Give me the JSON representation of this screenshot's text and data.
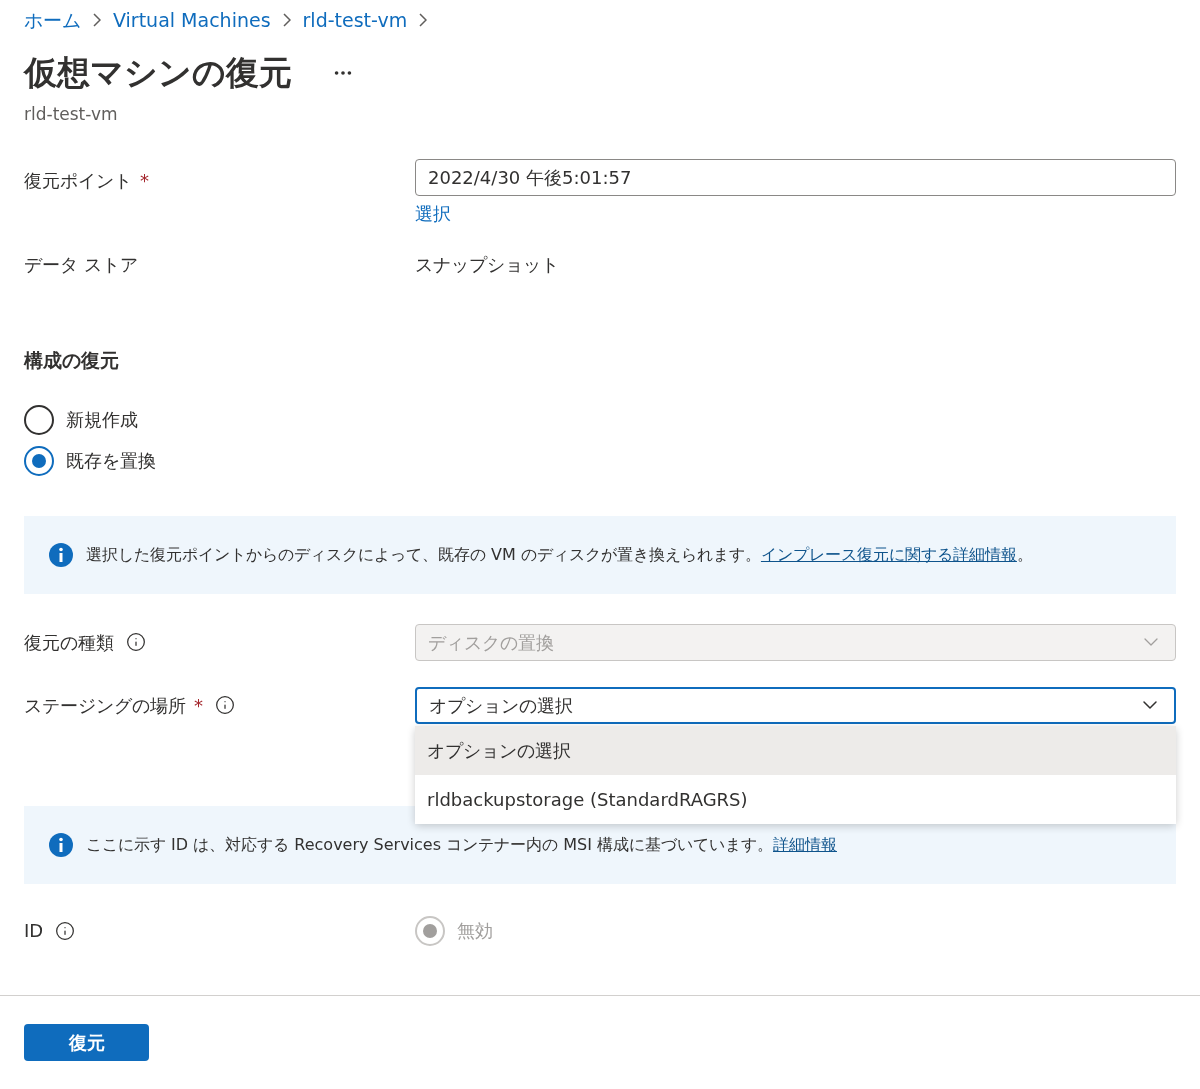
{
  "breadcrumb": [
    "ホーム",
    "Virtual Machines",
    "rld-test-vm"
  ],
  "title": "仮想マシンの復元",
  "subtitle": "rld-test-vm",
  "restore_point": {
    "label": "復元ポイント",
    "required_mark": "*",
    "value": "2022/4/30 午後5:01:57",
    "link": "選択"
  },
  "data_store": {
    "label": "データ ストア",
    "value": "スナップショット"
  },
  "config": {
    "heading": "構成の復元",
    "options": [
      {
        "label": "新規作成",
        "selected": false
      },
      {
        "label": "既存を置換",
        "selected": true
      }
    ]
  },
  "info_replace": {
    "text": "選択した復元ポイントからのディスクによって、既存の VM のディスクが置き換えられます。",
    "link": "インプレース復元に関する詳細情報",
    "end": "。"
  },
  "restore_type": {
    "label": "復元の種類",
    "value": "ディスクの置換",
    "disabled": true
  },
  "staging": {
    "label": "ステージングの場所",
    "required_mark": "*",
    "value": "オプションの選択",
    "expanded": true,
    "options": [
      {
        "label": "オプションの選択",
        "selected": true
      },
      {
        "label": "rldbackupstorage (StandardRAGRS)",
        "selected": false
      }
    ]
  },
  "info_identity": {
    "text": "ここに示す ID は、対応する Recovery Services コンテナー内の MSI 構成に基づいています。",
    "link": "詳細情報"
  },
  "identity": {
    "label": "ID",
    "option": "無効",
    "selected": true,
    "disabled": true
  },
  "button": "復元"
}
